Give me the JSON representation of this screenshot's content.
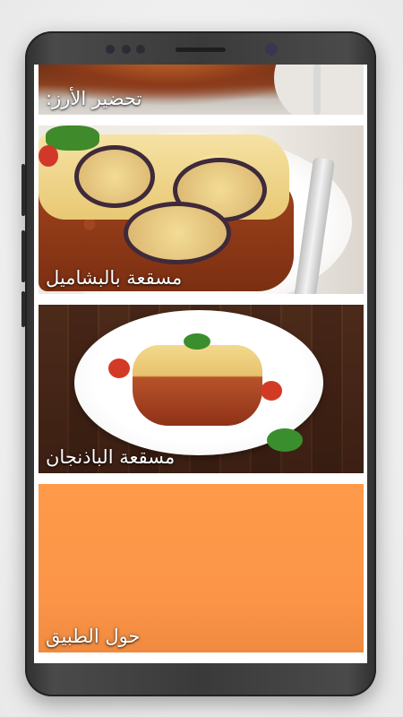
{
  "menu": {
    "items": [
      {
        "label": "تحضير الأرز:",
        "image_icon": "rice-dish-photo"
      },
      {
        "label": "مسقعة بالبشاميل",
        "image_icon": "moussaka-bechamel-photo"
      },
      {
        "label": "مسقعة الباذنجان",
        "image_icon": "eggplant-moussaka-photo"
      },
      {
        "label": "حول الطبيق",
        "background_color": "#ff9a4a"
      }
    ]
  },
  "colors": {
    "phone_frame": "#3a3a3a",
    "screen_bg": "#ffffff",
    "label_text": "#ffffff",
    "about_tile": "#ff9a4a"
  }
}
